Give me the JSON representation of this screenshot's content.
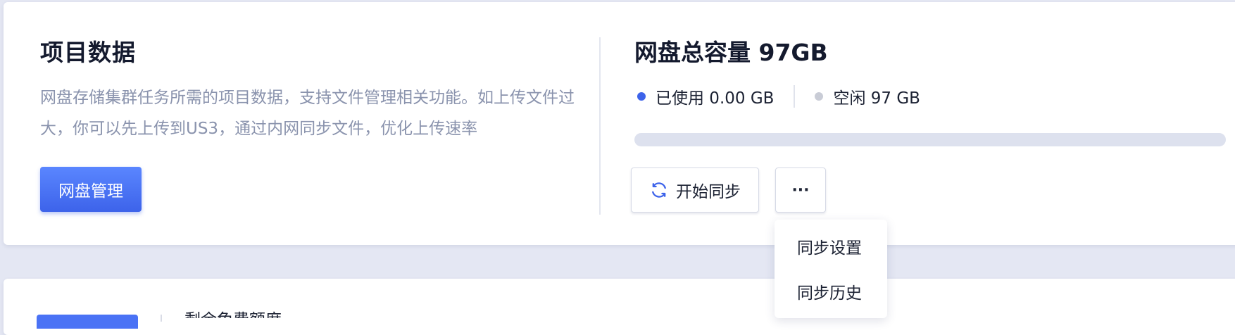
{
  "project": {
    "title": "项目数据",
    "description": "网盘存储集群任务所需的项目数据，支持文件管理相关功能。如上传文件过大，你可以先上传到US3，通过内网同步文件，优化上传速率",
    "manage_button_label": "网盘管理"
  },
  "storage": {
    "title": "网盘总容量 97GB",
    "used_label": "已使用 0.00 GB",
    "free_label": "空闲 97 GB",
    "used_fraction": 0.0,
    "sync_button_label": "开始同步",
    "sync_icon": "refresh-icon",
    "more_button_label": "···"
  },
  "more_menu": {
    "items": [
      {
        "label": "同步设置"
      },
      {
        "label": "同步历史"
      }
    ]
  },
  "next_card": {
    "partial_text": "剩余免费额度"
  },
  "colors": {
    "accent": "#3d63ea",
    "used_dot": "#3d63ea",
    "free_dot": "#c9ccd6",
    "progress_track": "#dde1ee",
    "description_text": "#8a93ad"
  }
}
